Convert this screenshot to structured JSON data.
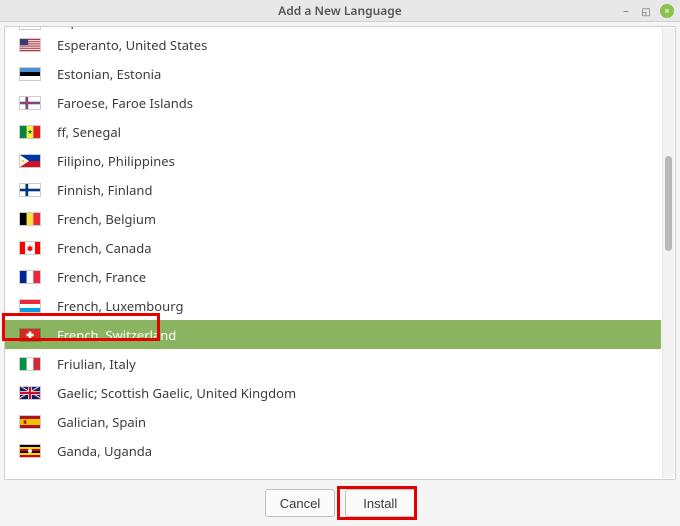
{
  "window": {
    "title": "Add a New Language"
  },
  "languages": [
    {
      "label": "Esperanto",
      "flag": "esperanto",
      "cut": true
    },
    {
      "label": "Esperanto, United States",
      "flag": "us"
    },
    {
      "label": "Estonian, Estonia",
      "flag": "ee"
    },
    {
      "label": "Faroese, Faroe Islands",
      "flag": "fo"
    },
    {
      "label": "ff, Senegal",
      "flag": "sn"
    },
    {
      "label": "Filipino, Philippines",
      "flag": "ph"
    },
    {
      "label": "Finnish, Finland",
      "flag": "fi"
    },
    {
      "label": "French, Belgium",
      "flag": "be"
    },
    {
      "label": "French, Canada",
      "flag": "ca"
    },
    {
      "label": "French, France",
      "flag": "fr"
    },
    {
      "label": "French, Luxembourg",
      "flag": "lu"
    },
    {
      "label": "French, Switzerland",
      "flag": "ch",
      "selected": true
    },
    {
      "label": "Friulian, Italy",
      "flag": "it"
    },
    {
      "label": "Gaelic; Scottish Gaelic, United Kingdom",
      "flag": "gb"
    },
    {
      "label": "Galician, Spain",
      "flag": "es"
    },
    {
      "label": "Ganda, Uganda",
      "flag": "ug"
    }
  ],
  "buttons": {
    "cancel": "Cancel",
    "install": "Install"
  }
}
